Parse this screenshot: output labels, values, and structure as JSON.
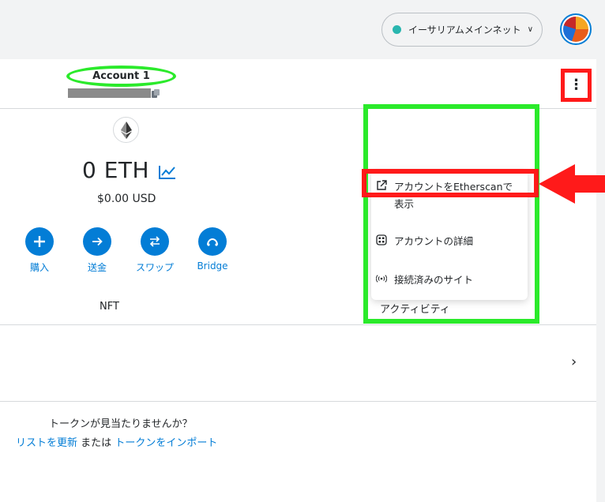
{
  "network": {
    "label": "イーサリアムメインネット",
    "dot_color": "#29b6af"
  },
  "account": {
    "name": "Account 1"
  },
  "balance": {
    "amount": "0 ETH",
    "fiat": "$0.00 USD"
  },
  "actions": [
    {
      "label": "購入",
      "icon": "plus-icon"
    },
    {
      "label": "送金",
      "icon": "arrow-right-icon"
    },
    {
      "label": "スワップ",
      "icon": "swap-icon"
    },
    {
      "label": "Bridge",
      "icon": "bridge-icon"
    }
  ],
  "tabs": {
    "nft": "NFT",
    "activity": "アクティビティ"
  },
  "menu": {
    "items": [
      {
        "label_line1": "アカウントをEtherscanで",
        "label_line2": "表示",
        "icon": "external-link-icon"
      },
      {
        "label": "アカウントの詳細",
        "icon": "qr-code-icon"
      },
      {
        "label": "接続済みのサイト",
        "icon": "connected-icon"
      }
    ]
  },
  "tokens": {
    "not_found": "トークンが見当たりませんか？",
    "refresh_link": "リストを更新",
    "or": "または",
    "import_link": "トークンをインポート"
  },
  "colors": {
    "accent": "#037dd6",
    "highlight_green": "#2bea2b",
    "highlight_red": "#ff1a1a"
  }
}
